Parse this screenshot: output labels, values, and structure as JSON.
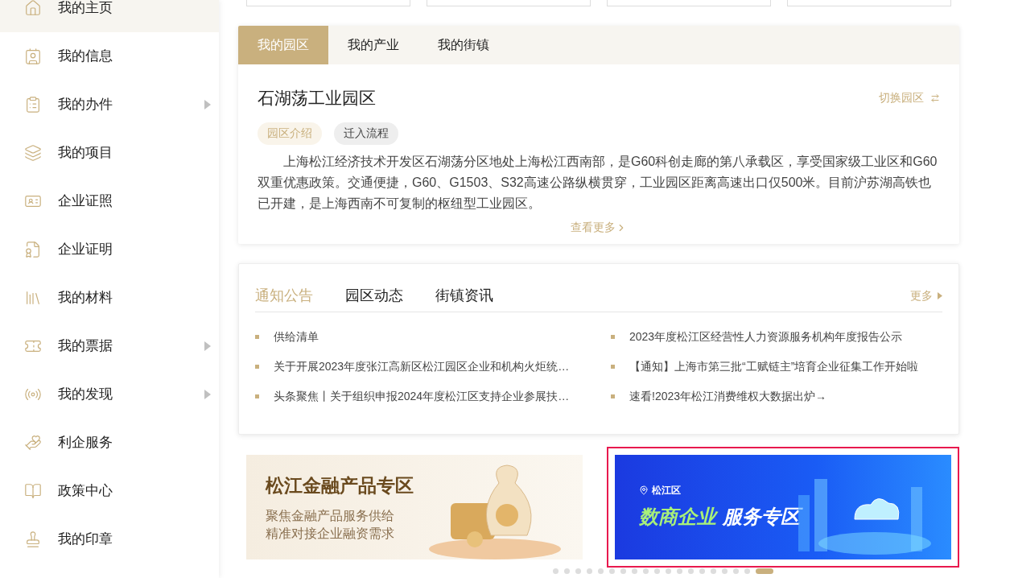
{
  "sidebar": {
    "items": [
      {
        "label": "我的主页",
        "selected": true,
        "has_submenu": false
      },
      {
        "label": "我的信息",
        "selected": false,
        "has_submenu": false
      },
      {
        "label": "我的办件",
        "selected": false,
        "has_submenu": true
      },
      {
        "label": "我的项目",
        "selected": false,
        "has_submenu": false
      },
      {
        "label": "企业证照",
        "selected": false,
        "has_submenu": false
      },
      {
        "label": "企业证明",
        "selected": false,
        "has_submenu": false
      },
      {
        "label": "我的材料",
        "selected": false,
        "has_submenu": false
      },
      {
        "label": "我的票据",
        "selected": false,
        "has_submenu": true
      },
      {
        "label": "我的发现",
        "selected": false,
        "has_submenu": true
      },
      {
        "label": "利企服务",
        "selected": false,
        "has_submenu": false
      },
      {
        "label": "政策中心",
        "selected": false,
        "has_submenu": false
      },
      {
        "label": "我的印章",
        "selected": false,
        "has_submenu": false
      }
    ]
  },
  "park_panel": {
    "tabs": [
      {
        "label": "我的园区",
        "selected": true
      },
      {
        "label": "我的产业",
        "selected": false
      },
      {
        "label": "我的街镇",
        "selected": false
      }
    ],
    "title": "石湖荡工业园区",
    "switch_link": "切换园区",
    "tags": [
      {
        "label": "园区介绍",
        "selected": true
      },
      {
        "label": "迁入流程",
        "selected": false
      }
    ],
    "description": "上海松江经济技术开发区石湖荡分区地处上海松江西南部，是G60科创走廊的第八承载区，享受国家级工业区和G60双重优惠政策。交通便捷，G60、G1503、S32高速公路纵横贯穿，工业园区距离高速出口仅500米。目前沪苏湖高铁也已开建，是上海西南不可复制的枢纽型工业园区。",
    "more_link": "查看更多"
  },
  "news_panel": {
    "tabs": [
      {
        "label": "通知公告",
        "selected": true
      },
      {
        "label": "园区动态",
        "selected": false
      },
      {
        "label": "街镇资讯",
        "selected": false
      }
    ],
    "more_link": "更多",
    "items": [
      "供给清单",
      "2023年度松江区经营性人力资源服务机构年度报告公示",
      "关于开展2023年度张江高新区松江园区企业和机构火炬统…",
      "【通知】上海市第三批“工赋链主”培育企业征集工作开始啦",
      "头条聚焦丨关于组织申报2024年度松江区支持企业参展扶…",
      "速看!2023年松江消费维权大数据出炉→"
    ]
  },
  "banners": [
    {
      "kind": "finance",
      "title": "松江金融产品专区",
      "subtitle_lines": [
        "聚焦金融产品服务供给",
        "精准对接企业融资需求"
      ],
      "highlighted": false
    },
    {
      "kind": "digital",
      "location": "松江区",
      "title_accent": "数商企业",
      "title": "服务专区",
      "highlighted": true
    }
  ],
  "carousel": {
    "dots": [
      {
        "selected": false
      },
      {
        "selected": false
      },
      {
        "selected": false
      },
      {
        "selected": false
      },
      {
        "selected": false
      },
      {
        "selected": false
      },
      {
        "selected": false
      },
      {
        "selected": false
      },
      {
        "selected": false
      },
      {
        "selected": false
      },
      {
        "selected": false
      },
      {
        "selected": false
      },
      {
        "selected": false
      },
      {
        "selected": false
      },
      {
        "selected": false
      },
      {
        "selected": false
      },
      {
        "selected": false
      },
      {
        "selected": false
      },
      {
        "selected": true
      }
    ]
  }
}
